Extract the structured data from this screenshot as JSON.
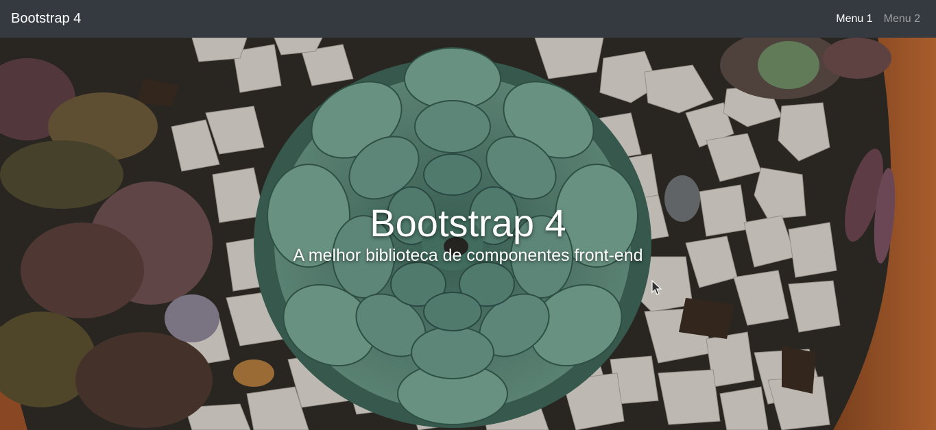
{
  "navbar": {
    "brand": "Bootstrap 4",
    "links": [
      {
        "label": "Menu 1",
        "state": "active"
      },
      {
        "label": "Menu 2",
        "state": "inactive"
      }
    ],
    "background": "#343a40"
  },
  "hero": {
    "title": "Bootstrap 4",
    "subtitle": "A melhor biblioteca de componentes front-end",
    "background_image": "succulent-and-white-stones-photo"
  },
  "colors": {
    "nav_text": "#ffffff",
    "nav_text_muted": "rgba(255,255,255,0.5)",
    "succulent": "#5e8a7a",
    "stones": "#d9d4cb",
    "pot": "#b8642f"
  }
}
